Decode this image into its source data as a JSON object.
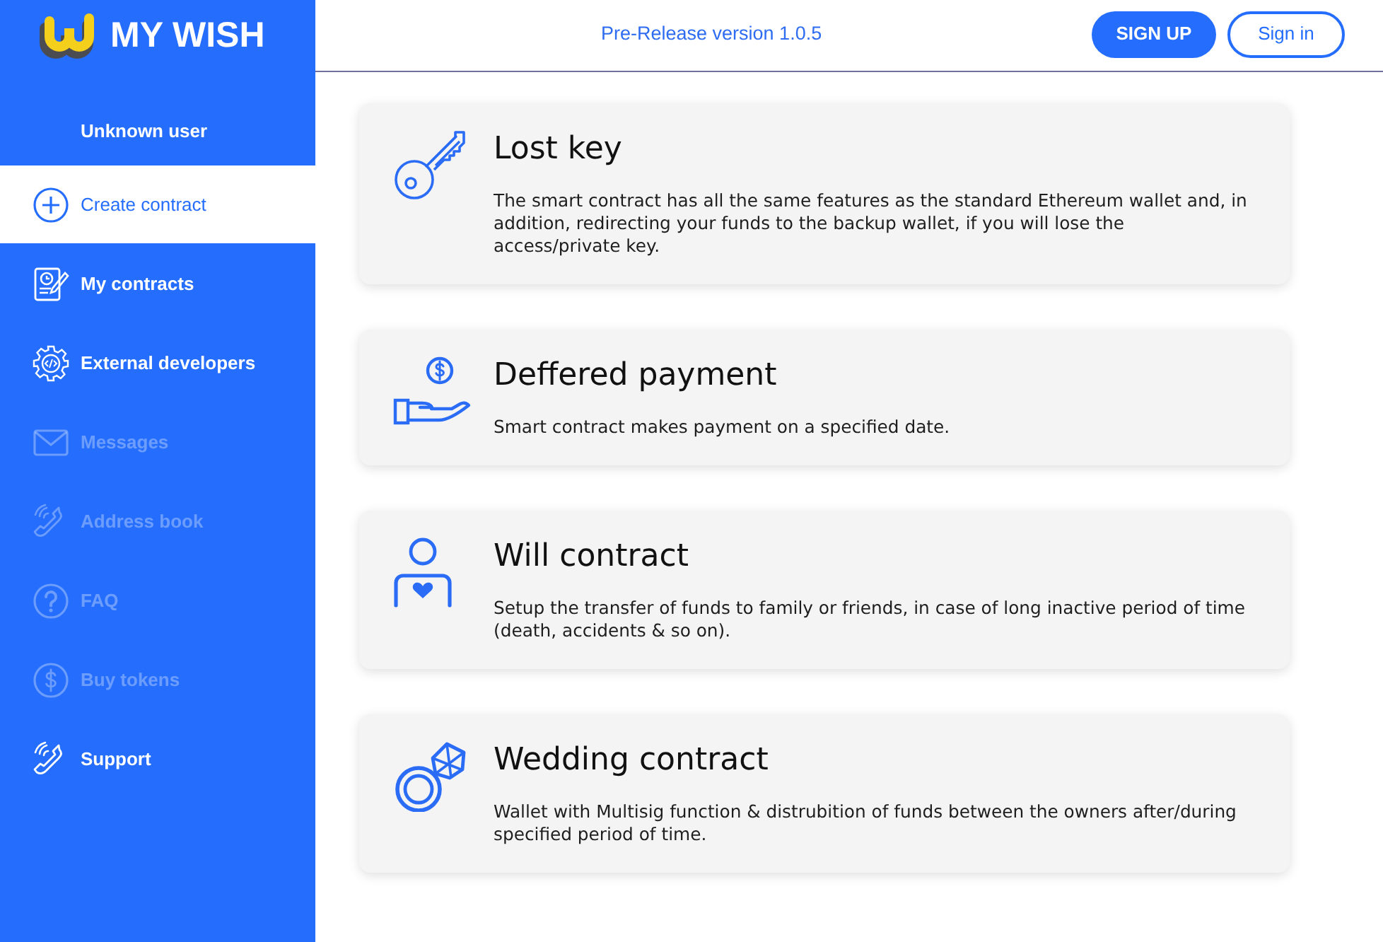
{
  "brand": {
    "name": "MY WISH"
  },
  "user": {
    "name": "Unknown user"
  },
  "sidebar": {
    "items": [
      {
        "label": "Create contract",
        "selected": true,
        "disabled": false
      },
      {
        "label": "My contracts",
        "selected": false,
        "disabled": false
      },
      {
        "label": "External developers",
        "selected": false,
        "disabled": false
      },
      {
        "label": "Messages",
        "selected": false,
        "disabled": true
      },
      {
        "label": "Address book",
        "selected": false,
        "disabled": true
      },
      {
        "label": "FAQ",
        "selected": false,
        "disabled": true
      },
      {
        "label": "Buy tokens",
        "selected": false,
        "disabled": true
      },
      {
        "label": "Support",
        "selected": false,
        "disabled": false
      }
    ]
  },
  "header": {
    "version": "Pre-Release version 1.0.5",
    "buttons": [
      {
        "label": "SIGN UP",
        "kind": "filled"
      },
      {
        "label": "Sign in",
        "kind": "outline"
      }
    ]
  },
  "contracts": [
    {
      "title": "Lost key",
      "description": "The smart contract has all the same features as the standard Ethereum wallet and, in addition, redirecting your funds to the backup wallet, if you will lose the access/private key."
    },
    {
      "title": "Deffered payment",
      "description": "Smart contract makes payment on a specified date."
    },
    {
      "title": "Will contract",
      "description": "Setup the transfer of funds to family or friends, in case of long inactive period of time (death, accidents & so on)."
    },
    {
      "title": "Wedding contract",
      "description": "Wallet with Multisig function & distrubition of funds between the owners after/during specified period of time."
    }
  ]
}
